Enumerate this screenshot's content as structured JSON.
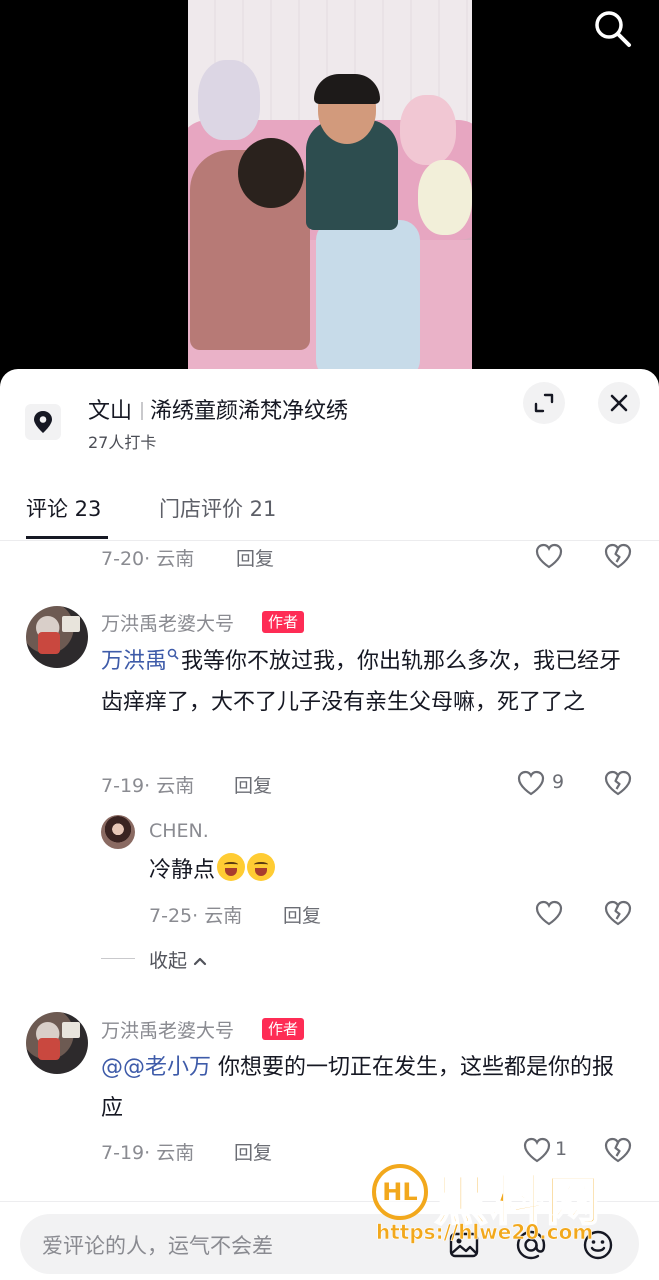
{
  "location": {
    "city": "文山",
    "shop_name": "浠绣童颜浠梵净纹绣",
    "checkins": "27人打卡"
  },
  "tabs": {
    "comments": "评论 23",
    "reviews": "门店评价 21"
  },
  "icons": {
    "search": "search-icon",
    "location": "location-pin-icon",
    "expand": "expand-icon",
    "close": "close-icon",
    "like": "heart-icon",
    "dislike": "broken-heart-icon",
    "image": "image-icon",
    "mention": "at-icon",
    "emoji": "emoji-icon"
  },
  "comments": [
    {
      "meta": "7-20· 云南",
      "reply": "回复"
    },
    {
      "author": "万洪禹老婆大号",
      "badge": "作者",
      "mention": "万洪禹",
      "text": "我等你不放过我，你出轨那么多次，我已经牙齿痒痒了，大不了儿子没有亲生父母嘛，死了了之",
      "meta": "7-19· 云南",
      "reply": "回复",
      "likes": "9",
      "replies": [
        {
          "author": "CHEN.",
          "text": "冷静点",
          "meta": "7-25· 云南",
          "reply": "回复"
        }
      ],
      "collapse": "收起"
    },
    {
      "author": "万洪禹老婆大号",
      "badge": "作者",
      "mention": "@@老小万",
      "text": " 你想要的一切正在发生，这些都是你的报应",
      "meta": "7-19· 云南",
      "reply": "回复",
      "likes": "1"
    }
  ],
  "input": {
    "placeholder": "爱评论的人，运气不会差"
  },
  "watermark": {
    "logo_text": "HL",
    "title": "黑料网",
    "url": "https://hlwe20.com"
  },
  "colors": {
    "author_badge": "#fe2c55",
    "mention": "#3e5ba9",
    "watermark": "#f2a81c"
  }
}
